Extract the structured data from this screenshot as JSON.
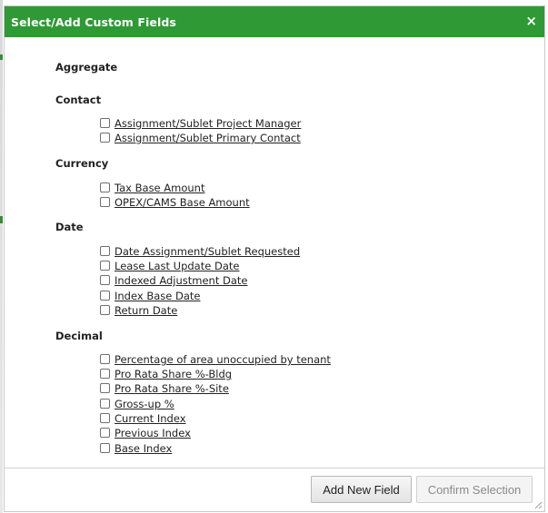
{
  "dialog": {
    "title": "Select/Add Custom Fields",
    "close_glyph": "×",
    "accent_color": "#2f9a35"
  },
  "groups": {
    "aggregate": "Aggregate",
    "contact": {
      "label": "Contact",
      "fields": [
        "Assignment/Sublet Project Manager",
        "Assignment/Sublet Primary Contact"
      ]
    },
    "currency": {
      "label": "Currency",
      "fields": [
        "Tax Base Amount",
        "OPEX/CAMS Base Amount"
      ]
    },
    "date": {
      "label": "Date",
      "fields": [
        "Date Assignment/Sublet Requested",
        "Lease Last Update Date",
        "Indexed Adjustment Date",
        "Index Base Date",
        "Return Date"
      ]
    },
    "decimal": {
      "label": "Decimal",
      "fields": [
        "Percentage of area unoccupied by tenant",
        "Pro Rata Share %-Bldg",
        "Pro Rata Share %-Site",
        "Gross-up %",
        "Current Index",
        "Previous Index",
        "Base Index"
      ]
    }
  },
  "footer": {
    "add_button": "Add New Field",
    "confirm_button": "Confirm Selection"
  },
  "icons": {
    "close": "close-icon",
    "checkbox": "checkbox-icon",
    "resize": "resize-grip-icon"
  }
}
